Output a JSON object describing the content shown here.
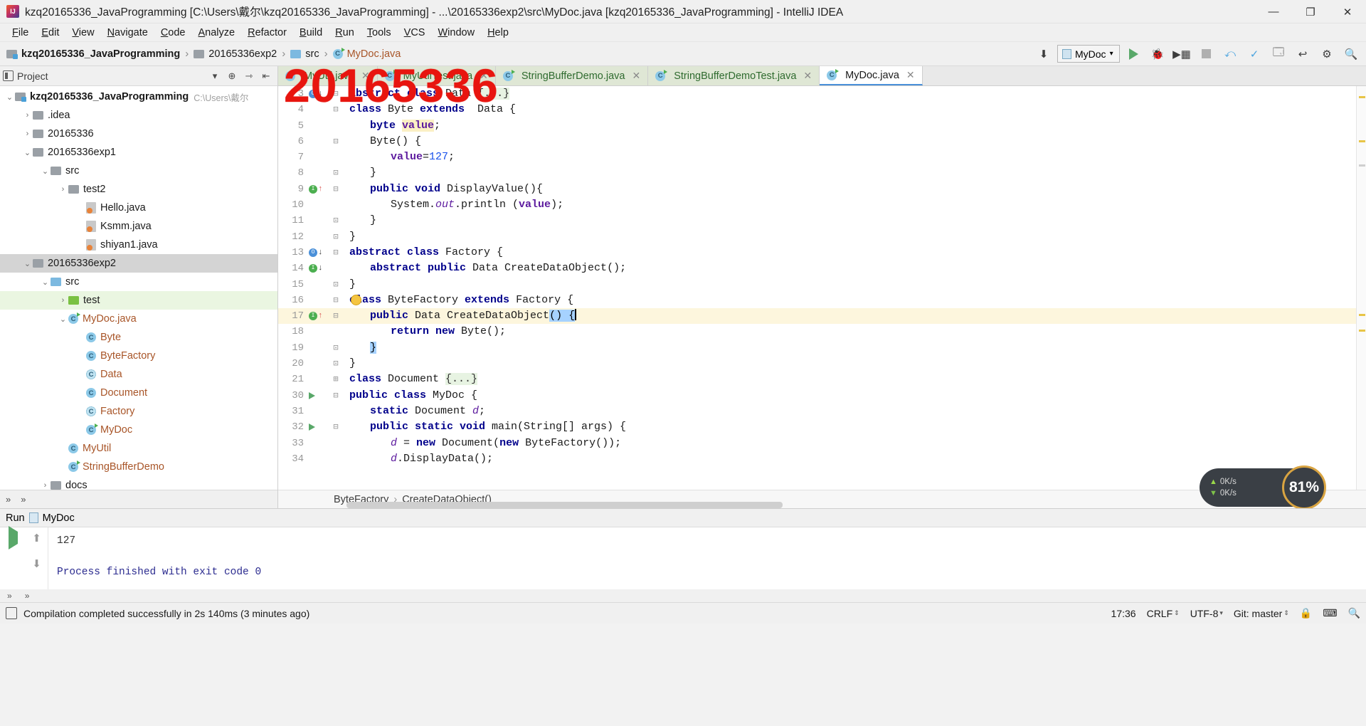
{
  "window": {
    "title": "kzq20165336_JavaProgramming [C:\\Users\\戴尔\\kzq20165336_JavaProgramming] - ...\\20165336exp2\\src\\MyDoc.java [kzq20165336_JavaProgramming] - IntelliJ IDEA",
    "minimize": "—",
    "maximize": "❐",
    "close": "✕"
  },
  "menu": [
    {
      "label": "File"
    },
    {
      "label": "Edit"
    },
    {
      "label": "View"
    },
    {
      "label": "Navigate"
    },
    {
      "label": "Code"
    },
    {
      "label": "Analyze"
    },
    {
      "label": "Refactor"
    },
    {
      "label": "Build"
    },
    {
      "label": "Run"
    },
    {
      "label": "Tools"
    },
    {
      "label": "VCS"
    },
    {
      "label": "Window"
    },
    {
      "label": "Help"
    }
  ],
  "breadcrumbs": [
    {
      "label": "kzq20165336_JavaProgramming",
      "icon": "project-folder-icon"
    },
    {
      "label": "20165336exp2",
      "icon": "folder-icon"
    },
    {
      "label": "src",
      "icon": "source-folder-icon"
    },
    {
      "label": "MyDoc.java",
      "icon": "java-class-icon"
    }
  ],
  "toolbar": {
    "run_config": "MyDoc",
    "run_label": "Run",
    "debug_label": "Debug",
    "coverage_label": "Run with Coverage",
    "stop_label": "Stop",
    "search_label": "Search Everywhere"
  },
  "project_panel": {
    "title": "Project",
    "tree": [
      {
        "depth": 0,
        "arrow": "v",
        "label": "kzq20165336_JavaProgramming",
        "path": "C:\\Users\\戴尔",
        "icon": "project-folder-icon",
        "bold": true,
        "state": "none"
      },
      {
        "depth": 1,
        "arrow": ">",
        "label": ".idea",
        "icon": "folder-icon",
        "state": "none"
      },
      {
        "depth": 1,
        "arrow": ">",
        "label": "20165336",
        "icon": "folder-icon",
        "state": "none"
      },
      {
        "depth": 1,
        "arrow": "v",
        "label": "20165336exp1",
        "icon": "folder-icon",
        "state": "none"
      },
      {
        "depth": 2,
        "arrow": "v",
        "label": "src",
        "icon": "folder-icon",
        "state": "none"
      },
      {
        "depth": 3,
        "arrow": ">",
        "label": "test2",
        "icon": "folder-icon",
        "state": "none"
      },
      {
        "depth": 4,
        "arrow": "",
        "label": "Hello.java",
        "icon": "java-file-icon",
        "state": "none"
      },
      {
        "depth": 4,
        "arrow": "",
        "label": "Ksmm.java",
        "icon": "java-file-icon",
        "state": "none"
      },
      {
        "depth": 4,
        "arrow": "",
        "label": "shiyan1.java",
        "icon": "java-file-icon",
        "state": "none"
      },
      {
        "depth": 1,
        "arrow": "v",
        "label": "20165336exp2",
        "icon": "folder-icon",
        "state": "grey"
      },
      {
        "depth": 2,
        "arrow": "v",
        "label": "src",
        "icon": "source-folder-icon",
        "state": "none"
      },
      {
        "depth": 3,
        "arrow": ">",
        "label": "test",
        "icon": "test-folder-icon",
        "state": "green"
      },
      {
        "depth": 3,
        "arrow": "v",
        "label": "MyDoc.java",
        "icon": "java-runnable-icon",
        "orange": true,
        "state": "none"
      },
      {
        "depth": 4,
        "arrow": "",
        "label": "Byte",
        "icon": "class-icon",
        "orange": true,
        "state": "none"
      },
      {
        "depth": 4,
        "arrow": "",
        "label": "ByteFactory",
        "icon": "class-icon",
        "orange": true,
        "state": "none"
      },
      {
        "depth": 4,
        "arrow": "",
        "label": "Data",
        "icon": "abstract-class-icon",
        "orange": true,
        "state": "none"
      },
      {
        "depth": 4,
        "arrow": "",
        "label": "Document",
        "icon": "class-icon",
        "orange": true,
        "state": "none"
      },
      {
        "depth": 4,
        "arrow": "",
        "label": "Factory",
        "icon": "abstract-class-icon",
        "orange": true,
        "state": "none"
      },
      {
        "depth": 4,
        "arrow": "",
        "label": "MyDoc",
        "icon": "runnable-class-icon",
        "orange": true,
        "state": "none"
      },
      {
        "depth": 3,
        "arrow": "",
        "label": "MyUtil",
        "icon": "class-icon",
        "orange": true,
        "state": "none"
      },
      {
        "depth": 3,
        "arrow": "",
        "label": "StringBufferDemo",
        "icon": "runnable-class-icon",
        "orange": true,
        "state": "none"
      },
      {
        "depth": 2,
        "arrow": ">",
        "label": "docs",
        "icon": "folder-icon",
        "state": "none"
      }
    ]
  },
  "editor": {
    "tabs": [
      {
        "label": "MyUtil.java",
        "icon": "java-class-icon",
        "active": false,
        "closable": true
      },
      {
        "label": "MyUtilTest.java",
        "icon": "java-class-icon",
        "active": false,
        "closable": true
      },
      {
        "label": "StringBufferDemo.java",
        "icon": "java-class-icon",
        "active": false,
        "closable": true
      },
      {
        "label": "StringBufferDemoTest.java",
        "icon": "java-class-icon",
        "active": false,
        "closable": true
      },
      {
        "label": "MyDoc.java",
        "icon": "java-class-icon",
        "active": true,
        "closable": true
      }
    ],
    "lines": [
      {
        "num": "3",
        "gicon": "blue-down",
        "fold": "-",
        "indent": 0,
        "tokens": [
          {
            "t": "abstract",
            "c": "kw"
          },
          {
            "t": " ",
            "c": "id"
          },
          {
            "t": "class",
            "c": "kw"
          },
          {
            "t": " Data ",
            "c": "id"
          },
          {
            "t": "{...}",
            "c": "fold"
          }
        ]
      },
      {
        "num": "4",
        "gicon": "",
        "fold": "-",
        "indent": 0,
        "tokens": [
          {
            "t": "class",
            "c": "kw"
          },
          {
            "t": " Byte ",
            "c": "id"
          },
          {
            "t": "extends",
            "c": "kw"
          },
          {
            "t": "  Data {",
            "c": "id"
          }
        ]
      },
      {
        "num": "5",
        "gicon": "",
        "fold": "",
        "indent": 1,
        "tokens": [
          {
            "t": "byte",
            "c": "kw"
          },
          {
            "t": " ",
            "c": "id"
          },
          {
            "t": "value",
            "c": "fld-hl"
          },
          {
            "t": ";",
            "c": "id"
          }
        ]
      },
      {
        "num": "6",
        "gicon": "",
        "fold": "-",
        "indent": 1,
        "tokens": [
          {
            "t": "Byte() {",
            "c": "id"
          }
        ]
      },
      {
        "num": "7",
        "gicon": "",
        "fold": "",
        "indent": 2,
        "tokens": [
          {
            "t": "value",
            "c": "fld"
          },
          {
            "t": "=",
            "c": "id"
          },
          {
            "t": "127",
            "c": "num"
          },
          {
            "t": ";",
            "c": "id"
          }
        ]
      },
      {
        "num": "8",
        "gicon": "",
        "fold": "end",
        "indent": 1,
        "tokens": [
          {
            "t": "}",
            "c": "id"
          }
        ]
      },
      {
        "num": "9",
        "gicon": "green-up",
        "fold": "-",
        "indent": 1,
        "tokens": [
          {
            "t": "public void",
            "c": "kw"
          },
          {
            "t": " DisplayValue(){",
            "c": "id"
          }
        ]
      },
      {
        "num": "10",
        "gicon": "",
        "fold": "",
        "indent": 2,
        "tokens": [
          {
            "t": "System.",
            "c": "id"
          },
          {
            "t": "out",
            "c": "stat"
          },
          {
            "t": ".println (",
            "c": "id"
          },
          {
            "t": "value",
            "c": "fld"
          },
          {
            "t": ");",
            "c": "id"
          }
        ]
      },
      {
        "num": "11",
        "gicon": "",
        "fold": "end",
        "indent": 1,
        "tokens": [
          {
            "t": "}",
            "c": "id"
          }
        ]
      },
      {
        "num": "12",
        "gicon": "",
        "fold": "end",
        "indent": 0,
        "tokens": [
          {
            "t": "}",
            "c": "id"
          }
        ]
      },
      {
        "num": "13",
        "gicon": "blue-down",
        "fold": "-",
        "indent": 0,
        "tokens": [
          {
            "t": "abstract class",
            "c": "kw"
          },
          {
            "t": " Factory {",
            "c": "id"
          }
        ]
      },
      {
        "num": "14",
        "gicon": "green-down",
        "fold": "",
        "indent": 1,
        "tokens": [
          {
            "t": "abstract public",
            "c": "kw"
          },
          {
            "t": " Data CreateDataObject();",
            "c": "id"
          }
        ]
      },
      {
        "num": "15",
        "gicon": "",
        "fold": "end",
        "indent": 0,
        "tokens": [
          {
            "t": "}",
            "c": "id"
          }
        ]
      },
      {
        "num": "16",
        "gicon": "",
        "fold": "-",
        "indent": 0,
        "bulb": true,
        "tokens": [
          {
            "t": "class",
            "c": "kw"
          },
          {
            "t": " ByteFactory ",
            "c": "id"
          },
          {
            "t": "extends",
            "c": "kw"
          },
          {
            "t": " Factory {",
            "c": "id"
          }
        ]
      },
      {
        "num": "17",
        "gicon": "green-up",
        "fold": "-",
        "indent": 1,
        "highlight": true,
        "tokens": [
          {
            "t": "public",
            "c": "kw"
          },
          {
            "t": " Data CreateDataObject",
            "c": "id"
          },
          {
            "t": "() {",
            "c": "sel"
          },
          {
            "t": "|",
            "c": "caret"
          }
        ]
      },
      {
        "num": "18",
        "gicon": "",
        "fold": "",
        "indent": 2,
        "tokens": [
          {
            "t": "return new",
            "c": "kw"
          },
          {
            "t": " Byte();",
            "c": "id"
          }
        ]
      },
      {
        "num": "19",
        "gicon": "",
        "fold": "end",
        "indent": 1,
        "tokens": [
          {
            "t": "}",
            "c": "sel"
          }
        ]
      },
      {
        "num": "20",
        "gicon": "",
        "fold": "end",
        "indent": 0,
        "tokens": [
          {
            "t": "}",
            "c": "id"
          }
        ]
      },
      {
        "num": "21",
        "gicon": "",
        "fold": "+",
        "indent": 0,
        "tokens": [
          {
            "t": "class",
            "c": "kw"
          },
          {
            "t": " Document ",
            "c": "id"
          },
          {
            "t": "{...}",
            "c": "fold"
          }
        ]
      },
      {
        "num": "30",
        "gicon": "run",
        "fold": "-",
        "indent": 0,
        "tokens": [
          {
            "t": "public class",
            "c": "kw"
          },
          {
            "t": " MyDoc {",
            "c": "id"
          }
        ]
      },
      {
        "num": "31",
        "gicon": "",
        "fold": "",
        "indent": 1,
        "tokens": [
          {
            "t": "static",
            "c": "kw"
          },
          {
            "t": " Document ",
            "c": "id"
          },
          {
            "t": "d",
            "c": "stat"
          },
          {
            "t": ";",
            "c": "id"
          }
        ]
      },
      {
        "num": "32",
        "gicon": "run",
        "fold": "-",
        "indent": 1,
        "tokens": [
          {
            "t": "public static void",
            "c": "kw"
          },
          {
            "t": " main(String[] args) {",
            "c": "id"
          }
        ]
      },
      {
        "num": "33",
        "gicon": "",
        "fold": "",
        "indent": 2,
        "tokens": [
          {
            "t": "d",
            "c": "stat"
          },
          {
            "t": " = ",
            "c": "id"
          },
          {
            "t": "new",
            "c": "kw"
          },
          {
            "t": " Document(",
            "c": "id"
          },
          {
            "t": "new",
            "c": "kw"
          },
          {
            "t": " ByteFactory());",
            "c": "id"
          }
        ]
      },
      {
        "num": "34",
        "gicon": "",
        "fold": "",
        "indent": 2,
        "tokens": [
          {
            "t": "d",
            "c": "stat"
          },
          {
            "t": ".DisplayData();",
            "c": "id"
          }
        ]
      }
    ],
    "breadcrumb": [
      {
        "label": "ByteFactory"
      },
      {
        "label": "CreateDataObject()"
      }
    ]
  },
  "net_widget": {
    "up_speed": "0K/s",
    "down_speed": "0K/s",
    "percent": "81%"
  },
  "run_panel": {
    "title": "Run",
    "config_name": "MyDoc",
    "output_lines": [
      "127",
      "",
      "Process finished with exit code 0"
    ],
    "rerun_label": "Rerun",
    "stop_label": "Stop",
    "up_label": "Up the Stack Trace",
    "down_label": "Down the Stack Trace"
  },
  "status_bar": {
    "message": "Compilation completed successfully in 2s 140ms (3 minutes ago)",
    "time": "17:36",
    "line_sep": "CRLF",
    "encoding": "UTF-8",
    "branch": "Git: master",
    "lock_icon": "lock-icon",
    "event_icon": "event-log-icon",
    "search_icon": "search-icon"
  },
  "watermark": "20165336"
}
